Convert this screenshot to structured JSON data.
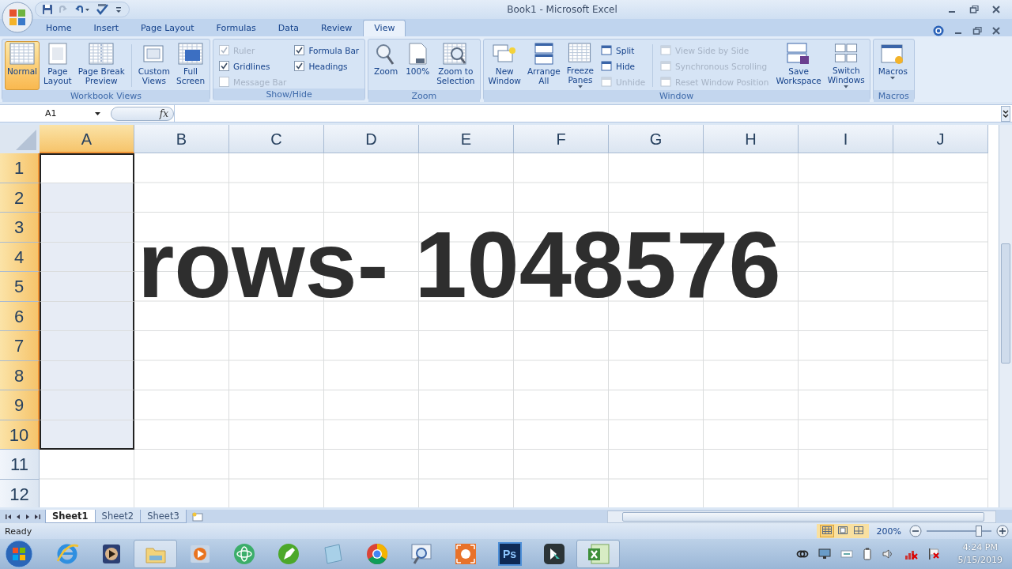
{
  "window": {
    "title": "Book1 - Microsoft Excel"
  },
  "tabs": [
    {
      "label": "Home",
      "selected": false
    },
    {
      "label": "Insert",
      "selected": false
    },
    {
      "label": "Page Layout",
      "selected": false
    },
    {
      "label": "Formulas",
      "selected": false
    },
    {
      "label": "Data",
      "selected": false
    },
    {
      "label": "Review",
      "selected": false
    },
    {
      "label": "View",
      "selected": true
    }
  ],
  "ribbon": {
    "groups": [
      {
        "name": "Workbook Views",
        "columns": [
          {
            "kind": "big",
            "label": "Normal",
            "selected": true,
            "dropdown": false
          },
          {
            "kind": "big",
            "label": "Page\nLayout",
            "selected": false,
            "dropdown": false
          },
          {
            "kind": "big",
            "label": "Page Break\nPreview",
            "selected": false,
            "dropdown": false
          },
          {
            "kind": "separator"
          },
          {
            "kind": "big",
            "label": "Custom\nViews",
            "selected": false,
            "dropdown": false
          },
          {
            "kind": "big",
            "label": "Full\nScreen",
            "selected": false,
            "dropdown": false
          }
        ]
      },
      {
        "name": "Show/Hide",
        "columns": [
          {
            "kind": "stack",
            "items": [
              {
                "kind": "check",
                "label": "Ruler",
                "checked": true,
                "disabled": true
              },
              {
                "kind": "check",
                "label": "Gridlines",
                "checked": true,
                "disabled": false
              },
              {
                "kind": "check",
                "label": "Message Bar",
                "checked": false,
                "disabled": true
              }
            ]
          },
          {
            "kind": "stack",
            "items": [
              {
                "kind": "check",
                "label": "Formula Bar",
                "checked": true,
                "disabled": false
              },
              {
                "kind": "check",
                "label": "Headings",
                "checked": true,
                "disabled": false
              }
            ]
          }
        ]
      },
      {
        "name": "Zoom",
        "columns": [
          {
            "kind": "big",
            "label": "Zoom",
            "selected": false,
            "dropdown": false
          },
          {
            "kind": "big",
            "label": "100%",
            "selected": false,
            "dropdown": false
          },
          {
            "kind": "big",
            "label": "Zoom to\nSelection",
            "selected": false,
            "dropdown": false
          }
        ]
      },
      {
        "name": "Window",
        "columns": [
          {
            "kind": "big",
            "label": "New\nWindow",
            "selected": false,
            "dropdown": false
          },
          {
            "kind": "big",
            "label": "Arrange\nAll",
            "selected": false,
            "dropdown": false
          },
          {
            "kind": "big",
            "label": "Freeze\nPanes",
            "selected": false,
            "dropdown": true
          },
          {
            "kind": "stack",
            "items": [
              {
                "kind": "small",
                "label": "Split",
                "disabled": false
              },
              {
                "kind": "small",
                "label": "Hide",
                "disabled": false
              },
              {
                "kind": "small",
                "label": "Unhide",
                "disabled": true
              }
            ]
          },
          {
            "kind": "separator"
          },
          {
            "kind": "stack",
            "items": [
              {
                "kind": "small",
                "label": "View Side by Side",
                "disabled": true
              },
              {
                "kind": "small",
                "label": "Synchronous Scrolling",
                "disabled": true
              },
              {
                "kind": "small",
                "label": "Reset Window Position",
                "disabled": true
              }
            ]
          },
          {
            "kind": "big",
            "label": "Save\nWorkspace",
            "selected": false,
            "dropdown": false
          },
          {
            "kind": "big",
            "label": "Switch\nWindows",
            "selected": false,
            "dropdown": true
          }
        ]
      },
      {
        "name": "Macros",
        "columns": [
          {
            "kind": "big",
            "label": "Macros",
            "selected": false,
            "dropdown": true
          }
        ]
      }
    ]
  },
  "formula_bar": {
    "name_box": "A1",
    "function_label": "fx"
  },
  "sheet": {
    "columns": [
      {
        "label": "A",
        "selected": true
      },
      {
        "label": "B",
        "selected": false
      },
      {
        "label": "C",
        "selected": false
      },
      {
        "label": "D",
        "selected": false
      },
      {
        "label": "E",
        "selected": false
      },
      {
        "label": "F",
        "selected": false
      },
      {
        "label": "G",
        "selected": false
      },
      {
        "label": "H",
        "selected": false
      },
      {
        "label": "I",
        "selected": false
      },
      {
        "label": "J",
        "selected": false
      }
    ],
    "rows": [
      {
        "label": "1",
        "selected": true
      },
      {
        "label": "2",
        "selected": true
      },
      {
        "label": "3",
        "selected": true
      },
      {
        "label": "4",
        "selected": true
      },
      {
        "label": "5",
        "selected": true
      },
      {
        "label": "6",
        "selected": true
      },
      {
        "label": "7",
        "selected": true
      },
      {
        "label": "8",
        "selected": true
      },
      {
        "label": "9",
        "selected": true
      },
      {
        "label": "10",
        "selected": true
      },
      {
        "label": "11",
        "selected": false
      },
      {
        "label": "12",
        "selected": false
      }
    ],
    "overlay_text": "rows- 1048576"
  },
  "sheet_tabs": [
    {
      "label": "Sheet1",
      "selected": true
    },
    {
      "label": "Sheet2",
      "selected": false
    },
    {
      "label": "Sheet3",
      "selected": false
    }
  ],
  "status_bar": {
    "status": "Ready",
    "views": [
      {
        "selected": true
      },
      {
        "selected": false
      },
      {
        "selected": false
      }
    ],
    "zoom": "200%",
    "zoom_slider": {
      "level": 0.8
    }
  },
  "taskbar": {
    "apps": [
      {
        "selected": false
      },
      {
        "selected": false
      },
      {
        "selected": true
      },
      {
        "selected": false
      },
      {
        "selected": false
      },
      {
        "selected": false
      },
      {
        "selected": false
      },
      {
        "selected": false
      },
      {
        "selected": false
      },
      {
        "selected": false
      },
      {
        "selected": false,
        "label": "Ps"
      },
      {
        "selected": false
      },
      {
        "selected": true
      }
    ],
    "clock": {
      "time": "4:24 PM",
      "date": "5/15/2019"
    }
  }
}
